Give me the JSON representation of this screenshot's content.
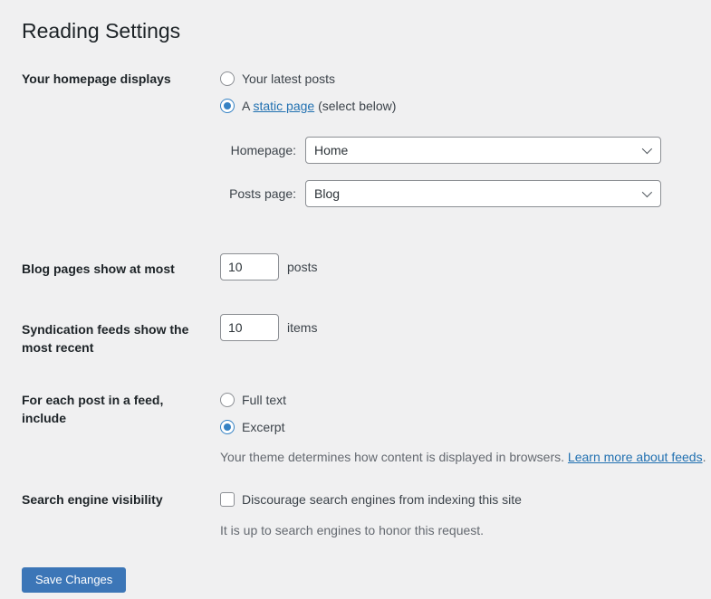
{
  "title": "Reading Settings",
  "colors": {
    "background": "#f0f0f1",
    "heading": "#1d2327",
    "link": "#2271b1",
    "radio_accent": "#3582c4",
    "button": "#3c76b7"
  },
  "form": {
    "homepage_displays": {
      "label": "Your homepage displays",
      "latest_posts_option": "Your latest posts",
      "latest_posts_selected": false,
      "static_page_prefix": "A",
      "static_page_link": "static page",
      "static_page_suffix": "(select below)",
      "static_page_selected": true,
      "homepage_select": {
        "label": "Homepage:",
        "value": "Home"
      },
      "posts_page_select": {
        "label": "Posts page:",
        "value": "Blog"
      }
    },
    "blog_pages": {
      "label": "Blog pages show at most",
      "value": "10",
      "unit": "posts"
    },
    "syndication_feeds": {
      "label": "Syndication feeds show the most recent",
      "value": "10",
      "unit": "items"
    },
    "feed_content": {
      "label": "For each post in a feed, include",
      "full_text_option": "Full text",
      "full_text_selected": false,
      "excerpt_option": "Excerpt",
      "excerpt_selected": true,
      "description_text": "Your theme determines how content is displayed in browsers.",
      "description_link": "Learn more about feeds",
      "description_end": "."
    },
    "search_visibility": {
      "label": "Search engine visibility",
      "checkbox_label": "Discourage search engines from indexing this site",
      "checkbox_checked": false,
      "description": "It is up to search engines to honor this request."
    }
  },
  "save_button_label": "Save Changes"
}
